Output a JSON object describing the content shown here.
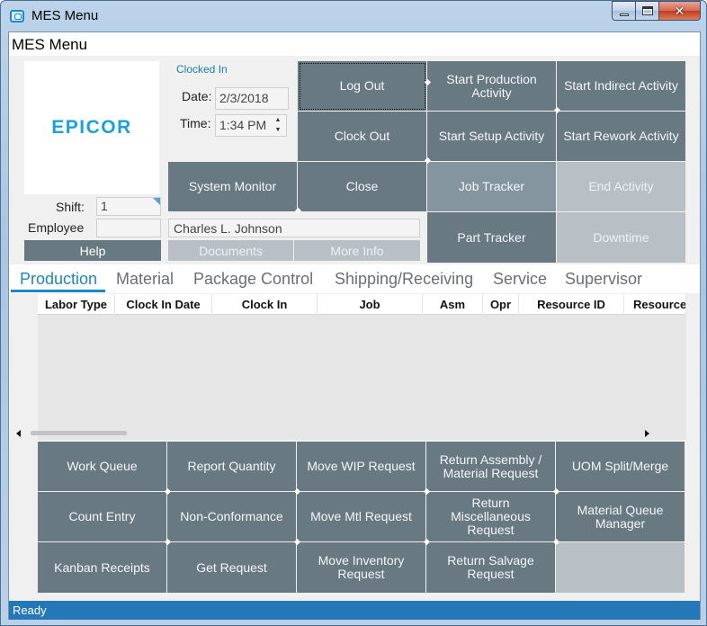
{
  "window": {
    "title": "MES Menu"
  },
  "header": {
    "title": "MES Menu"
  },
  "logo": {
    "text": "EPICOR",
    "color": "#1aa1dc"
  },
  "status_info": {
    "clocked_in": "Clocked In",
    "date_label": "Date:",
    "date_value": "2/3/2018",
    "time_label": "Time:",
    "time_value": "1:34 PM",
    "shift_label": "Shift:",
    "shift_value": "1",
    "employee_label": "Employee",
    "employee_id": "",
    "employee_name": "Charles L. Johnson"
  },
  "buttons": {
    "help": "Help",
    "documents": "Documents",
    "more_info": "More Info",
    "log_out": "Log Out",
    "clock_out": "Clock Out",
    "system_monitor": "System Monitor",
    "close": "Close",
    "start_production": "Start Production Activity",
    "start_setup": "Start Setup Activity",
    "job_tracker": "Job Tracker",
    "part_tracker": "Part Tracker",
    "start_indirect": "Start Indirect Activity",
    "start_rework": "Start Rework Activity",
    "end_activity": "End Activity",
    "downtime": "Downtime"
  },
  "tabs": [
    "Production",
    "Material",
    "Package Control",
    "Shipping/Receiving",
    "Service",
    "Supervisor"
  ],
  "grid": {
    "columns": [
      "Labor Type",
      "Clock In Date",
      "Clock In",
      "Job",
      "Asm",
      "Opr",
      "Resource ID",
      "Resource"
    ],
    "rows": []
  },
  "actions": {
    "work_queue": "Work Queue",
    "report_quantity": "Report Quantity",
    "move_wip_request": "Move WIP Request",
    "return_assembly": "Return Assembly / Material Request",
    "uom_split": "UOM Split/Merge",
    "count_entry": "Count Entry",
    "non_conformance": "Non-Conformance",
    "move_mtl_request": "Move Mtl Request",
    "return_misc": "Return Miscellaneous Request",
    "material_queue": "Material Queue Manager",
    "kanban_receipts": "Kanban Receipts",
    "get_request": "Get Request",
    "move_inventory": "Move Inventory Request",
    "return_salvage": "Return Salvage Request"
  },
  "statusbar": {
    "text": "Ready"
  },
  "colors": {
    "tile": "#687982",
    "tile_light": "#8495a0",
    "tile_disabled": "#b9c0c5",
    "accent": "#1d86c5",
    "statusbar": "#2578b8"
  }
}
